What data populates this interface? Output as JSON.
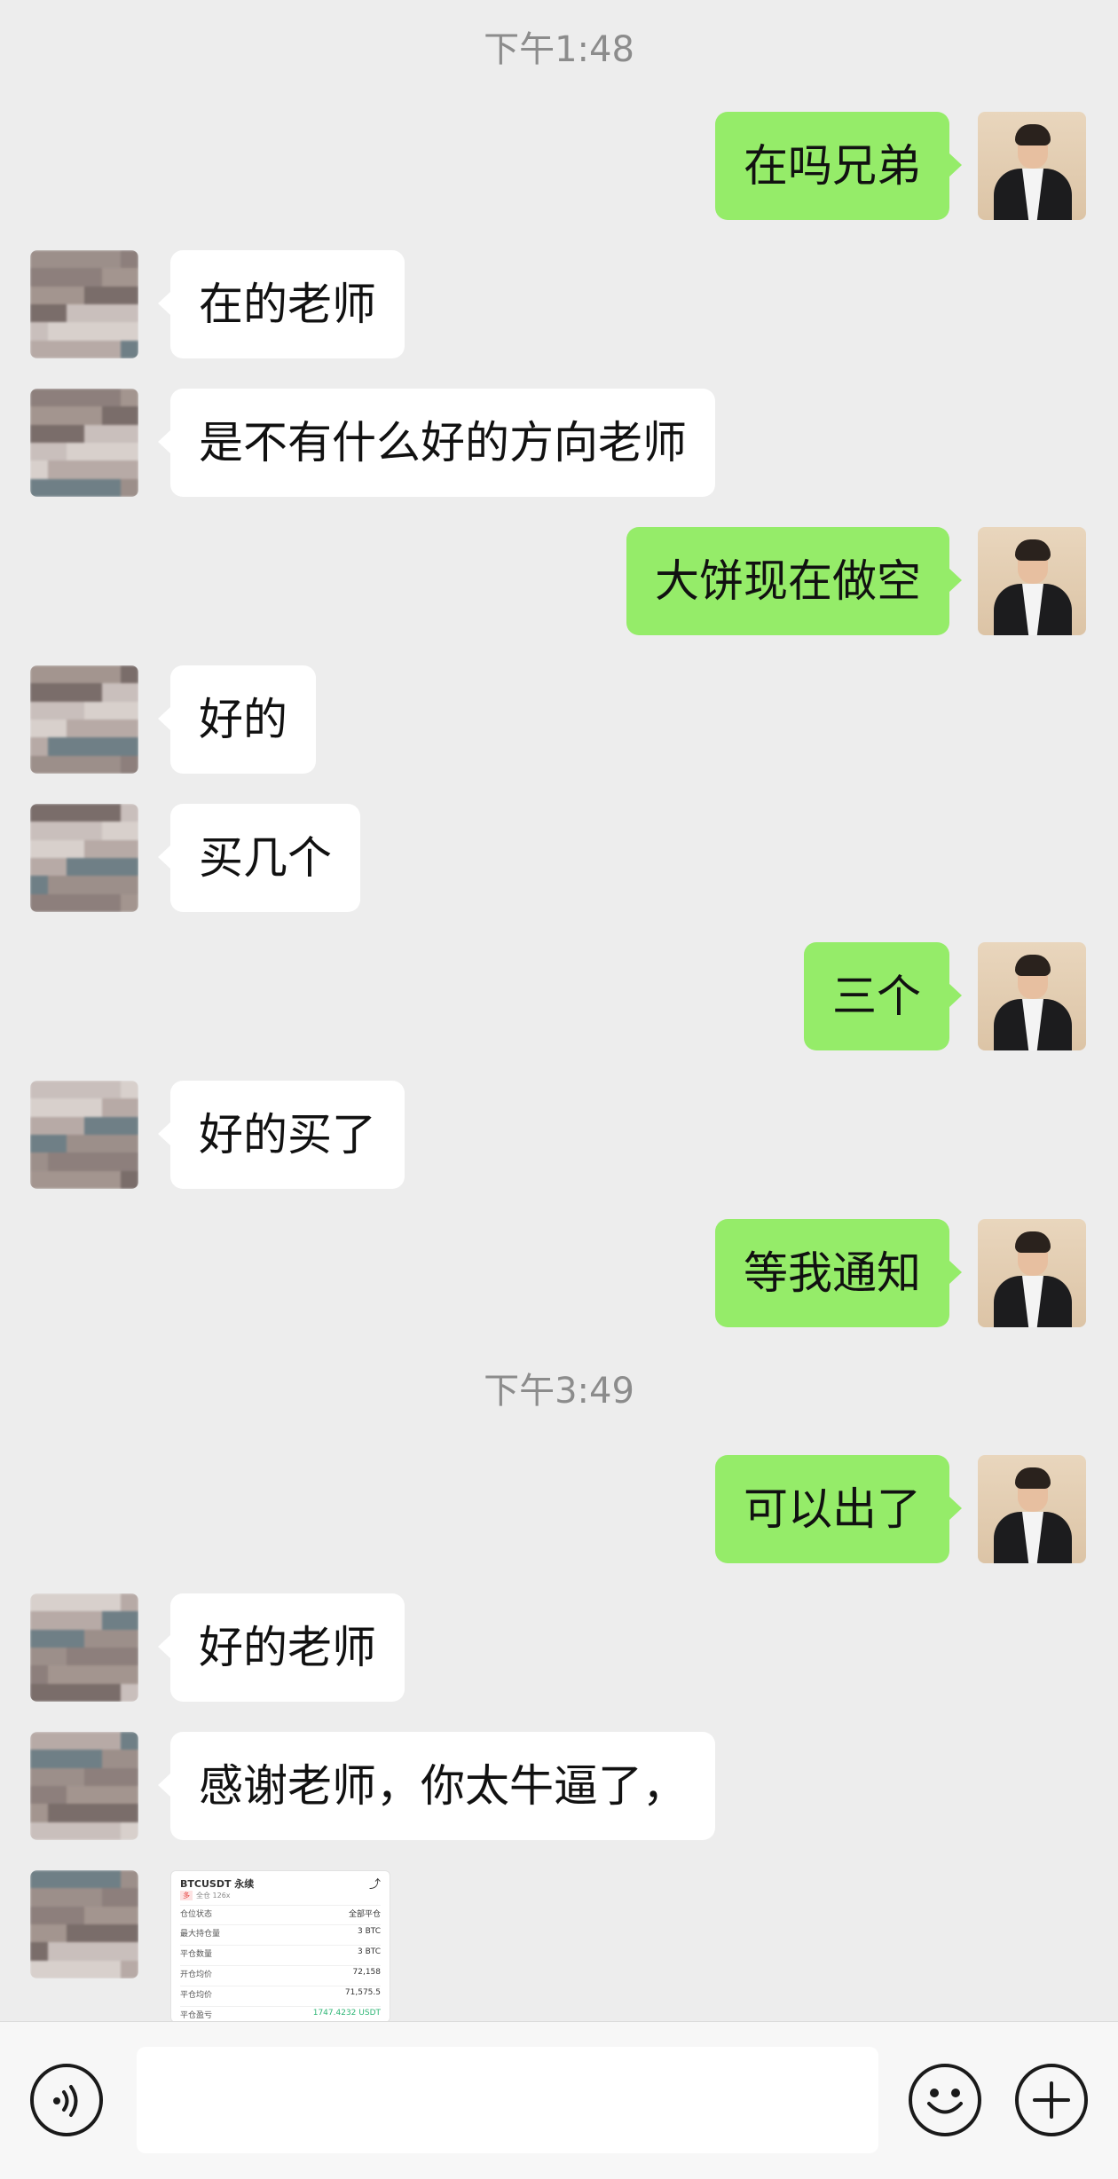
{
  "timestamps": [
    "下午1:48",
    "下午3:49"
  ],
  "messages": [
    {
      "side": "out",
      "text": "在吗兄弟"
    },
    {
      "side": "in",
      "text": "在的老师"
    },
    {
      "side": "in",
      "text": "是不有什么好的方向老师"
    },
    {
      "side": "out",
      "text": "大饼现在做空"
    },
    {
      "side": "in",
      "text": "好的"
    },
    {
      "side": "in",
      "text": "买几个"
    },
    {
      "side": "out",
      "text": "三个"
    },
    {
      "side": "in",
      "text": "好的买了"
    },
    {
      "side": "out",
      "text": "等我通知"
    },
    {
      "side": "out",
      "text": "可以出了"
    },
    {
      "side": "in",
      "text": "好的老师"
    },
    {
      "side": "in",
      "text": "感谢老师，你太牛逼了，"
    }
  ],
  "image_card": {
    "title": "BTCUSDT 永续",
    "tag_side": "多",
    "tag_text": "全仓 126x",
    "rows": [
      {
        "label": "仓位状态",
        "value": "全部平仓"
      },
      {
        "label": "最大持仓量",
        "value": "3 BTC"
      },
      {
        "label": "平仓数量",
        "value": "3 BTC"
      },
      {
        "label": "开仓均价",
        "value": "72,158"
      },
      {
        "label": "平仓均价",
        "value": "71,575.5"
      },
      {
        "label": "平仓盈亏",
        "value": "1747.4232 USDT"
      }
    ]
  },
  "input_bar": {
    "voice_icon": "voice-icon",
    "emoji_icon": "emoji-icon",
    "plus_icon": "plus-icon",
    "input_value": ""
  },
  "colors": {
    "background": "#ededed",
    "outgoing_bubble": "#95ec69",
    "incoming_bubble": "#ffffff",
    "timestamp_text": "#8c8c8c",
    "profit_text": "#2fb676"
  }
}
